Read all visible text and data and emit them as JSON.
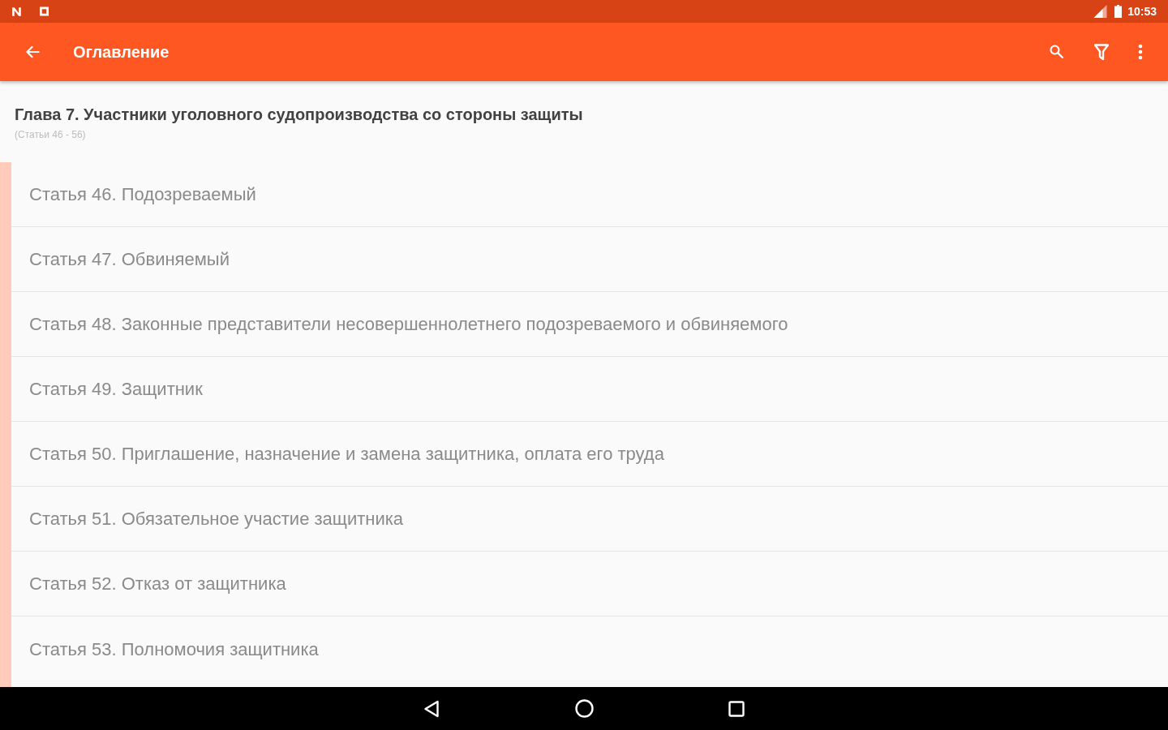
{
  "status_bar": {
    "time": "10:53"
  },
  "app_bar": {
    "title": "Оглавление"
  },
  "chapter": {
    "title": "Глава 7. Участники уголовного судопроизводства со стороны защиты",
    "subtitle": "(Статьи 46 - 56)"
  },
  "articles": [
    "Статья 46. Подозреваемый",
    "Статья 47. Обвиняемый",
    "Статья 48. Законные представители несовершеннолетнего подозреваемого и обвиняемого",
    "Статья 49. Защитник",
    "Статья 50. Приглашение, назначение и замена защитника, оплата его труда",
    "Статья 51. Обязательное участие защитника",
    "Статья 52. Отказ от защитника",
    "Статья 53. Полномочия защитника"
  ]
}
